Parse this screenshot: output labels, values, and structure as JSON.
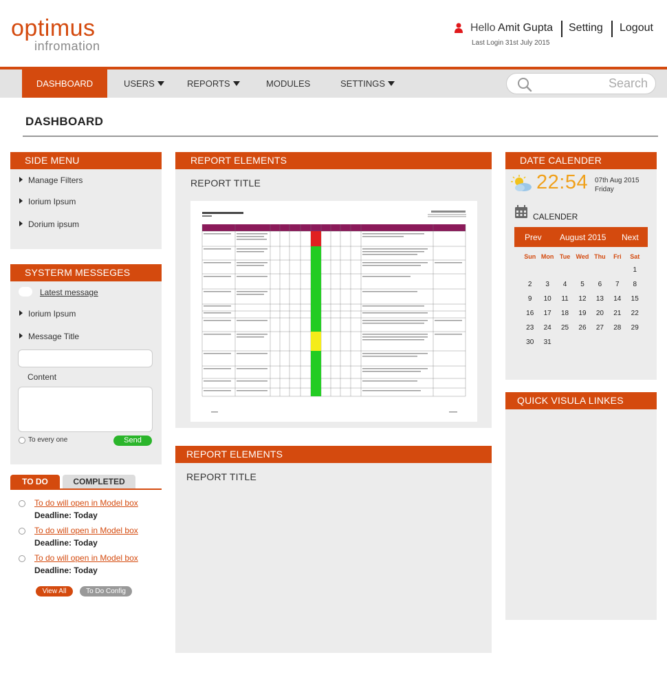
{
  "brand": {
    "name": "optimus",
    "subname": "infromation"
  },
  "header": {
    "greeting": "Hello",
    "user_name": "Amit Gupta",
    "setting_label": "Setting",
    "logout_label": "Logout",
    "last_login": "Last Login 31st July 2015"
  },
  "nav": {
    "items": [
      {
        "label": "DASHBOARD"
      },
      {
        "label": "USERS"
      },
      {
        "label": "REPORTS"
      },
      {
        "label": "MODULES"
      },
      {
        "label": "SETTINGS"
      }
    ],
    "search_placeholder": "Search"
  },
  "page": {
    "title": "DASHBOARD"
  },
  "side_menu": {
    "title": "SIDE MENU",
    "items": [
      {
        "label": "Manage Filters"
      },
      {
        "label": "Iorium Ipsum"
      },
      {
        "label": "Dorium ipsum"
      }
    ]
  },
  "system_messages": {
    "title": "SYSTERM MESSEGES",
    "latest_label": "Latest message",
    "items": [
      {
        "label": "Iorium Ipsum"
      },
      {
        "label": "Message Title"
      }
    ],
    "content_label": "Content",
    "recipient_label": "To every one",
    "send_label": "Send"
  },
  "todo": {
    "tab_todo": "TO DO",
    "tab_completed": "COMPLETED",
    "items": [
      {
        "link": "To do will open in Model box",
        "deadline": "Deadline: Today"
      },
      {
        "link": "To do will open in Model box",
        "deadline": "Deadline: Today"
      },
      {
        "link": "To do will open in Model box",
        "deadline": "Deadline: Today"
      }
    ],
    "view_all": "View All",
    "config": "To Do Config"
  },
  "reports": [
    {
      "title": "REPORT ELEMENTS",
      "subtitle": "REPORT TITLE"
    },
    {
      "title": "REPORT ELEMENTS",
      "subtitle": "REPORT TITLE"
    }
  ],
  "calendar": {
    "title": "DATE CALENDER",
    "time": "22:54",
    "date": "07th Aug 2015",
    "weekday": "Friday",
    "calender_label": "CALENDER",
    "prev": "Prev",
    "next": "Next",
    "month": "August 2015",
    "day_names": [
      "Sun",
      "Mon",
      "Tue",
      "Wed",
      "Thu",
      "Fri",
      "Sat"
    ],
    "weeks": [
      [
        "",
        "",
        "",
        "",
        "",
        "",
        "1"
      ],
      [
        "2",
        "3",
        "4",
        "5",
        "6",
        "7",
        "8"
      ],
      [
        "9",
        "10",
        "11",
        "12",
        "13",
        "14",
        "15"
      ],
      [
        "16",
        "17",
        "18",
        "19",
        "20",
        "21",
        "22"
      ],
      [
        "23",
        "24",
        "25",
        "26",
        "27",
        "28",
        "29"
      ],
      [
        "30",
        "31",
        "",
        "",
        "",
        "",
        ""
      ]
    ]
  },
  "quick_links": {
    "title": "QUICK VISULA LINKES"
  },
  "colors": {
    "accent": "#d44a0e",
    "panel": "#ececec",
    "time": "#f0a01a",
    "send": "#2bb52b"
  }
}
